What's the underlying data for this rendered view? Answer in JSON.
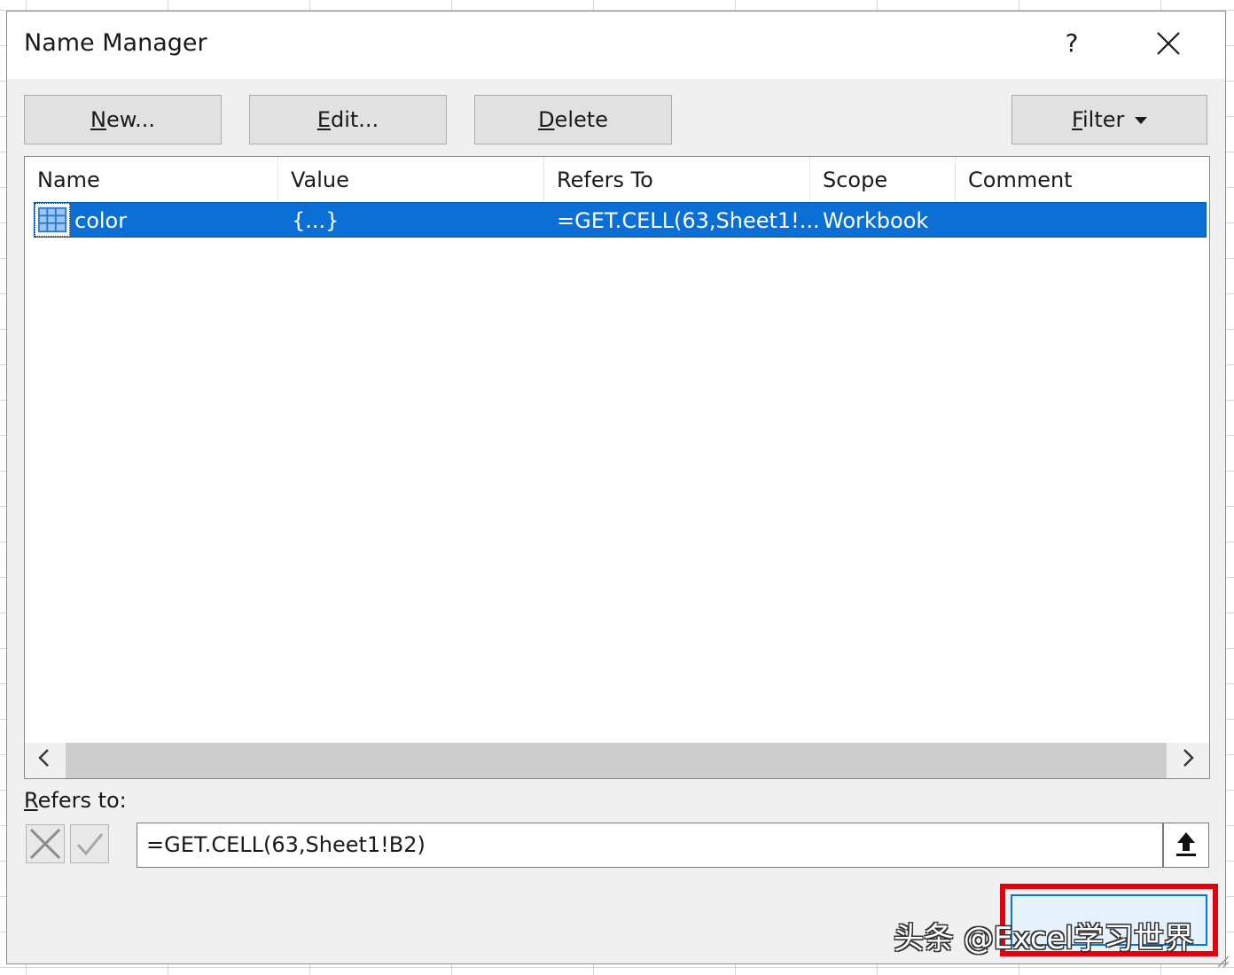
{
  "window": {
    "title": "Name Manager",
    "help_label": "?"
  },
  "toolbar": {
    "new": {
      "ul": "N",
      "rest": "ew..."
    },
    "edit": {
      "ul": "E",
      "rest": "dit..."
    },
    "delete": {
      "ul": "D",
      "rest": "elete"
    },
    "filter": {
      "ul": "F",
      "rest": "ilter"
    }
  },
  "table": {
    "columns": [
      "Name",
      "Value",
      "Refers To",
      "Scope",
      "Comment"
    ],
    "rows": [
      {
        "name": "color",
        "value": "{...}",
        "refers_to": "=GET.CELL(63,Sheet1!...",
        "scope": "Workbook",
        "comment": ""
      }
    ]
  },
  "refers": {
    "label_ul": "R",
    "label_rest": "efers to:",
    "value": "=GET.CELL(63,Sheet1!B2)"
  },
  "watermark": "头条 @Excel学习世界",
  "colors": {
    "selection": "#0b6fd6",
    "highlight": "#e3000f"
  }
}
